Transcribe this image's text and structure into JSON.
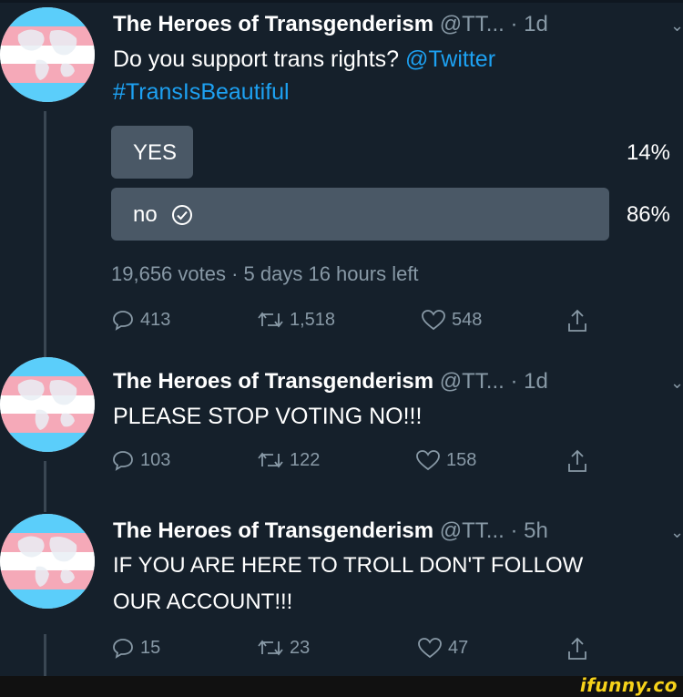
{
  "tweets": [
    {
      "name": "The Heroes of Transgenderism",
      "handle": "@TT...",
      "time": "· 1d",
      "line1": "Do you support trans rights?",
      "mention": "@Twitter",
      "hashtag": "#TransIsBeautiful",
      "poll": {
        "options": [
          {
            "label": "YES",
            "percent": "14%",
            "share": 0.14,
            "selected": false
          },
          {
            "label": "no",
            "percent": "86%",
            "share": 0.86,
            "selected": true
          }
        ],
        "meta": "19,656 votes · 5 days 16 hours left"
      },
      "replies": "413",
      "retweets": "1,518",
      "likes": "548"
    },
    {
      "name": "The Heroes of Transgenderism",
      "handle": "@TT...",
      "time": "· 1d",
      "line1": "PLEASE STOP VOTING NO!!!",
      "replies": "103",
      "retweets": "122",
      "likes": "158"
    },
    {
      "name": "The Heroes of Transgenderism",
      "handle": "@TT...",
      "time": "· 5h",
      "line1": "IF YOU ARE HERE TO TROLL DON'T FOLLOW",
      "line2": "OUR ACCOUNT!!!",
      "replies": "15",
      "retweets": "23",
      "likes": "47"
    }
  ],
  "icons": {
    "reply": "reply-icon",
    "retweet": "retweet-icon",
    "like": "heart-icon",
    "share": "share-icon",
    "caret": "chevron-down-icon",
    "check": "check-circle-icon"
  },
  "watermark": "ifunny.co",
  "colors": {
    "background": "#15202b",
    "link": "#1da1f2",
    "muted": "#8899a6",
    "poll_bar": "#4a5866",
    "watermark": "#f6d21a"
  }
}
